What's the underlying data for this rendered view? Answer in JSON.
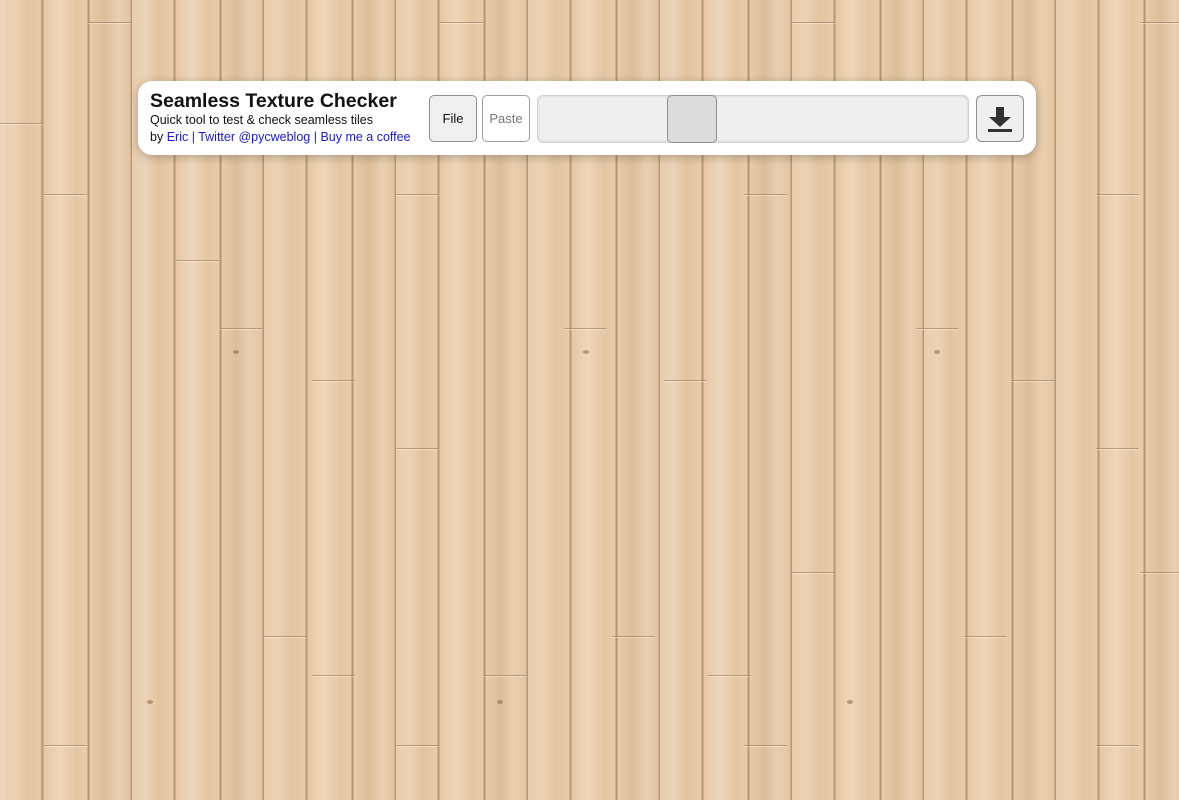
{
  "app": {
    "title": "Seamless Texture Checker",
    "subtitle": "Quick tool to test & check seamless tiles",
    "byline": {
      "prefix": "by ",
      "author_link": "Eric",
      "sep1": " | ",
      "twitter_link": "Twitter @pycweblog",
      "sep2": " | ",
      "coffee_link": "Buy me a coffee"
    }
  },
  "toolbar": {
    "file_label": "File",
    "paste_label": "Paste",
    "zoom_slider": {
      "value_fraction": 0.34
    },
    "download_icon": "download-icon"
  },
  "colors": {
    "link": "#1a1ad8",
    "panel_bg": "#ffffff",
    "wood": "#e8ccab"
  }
}
